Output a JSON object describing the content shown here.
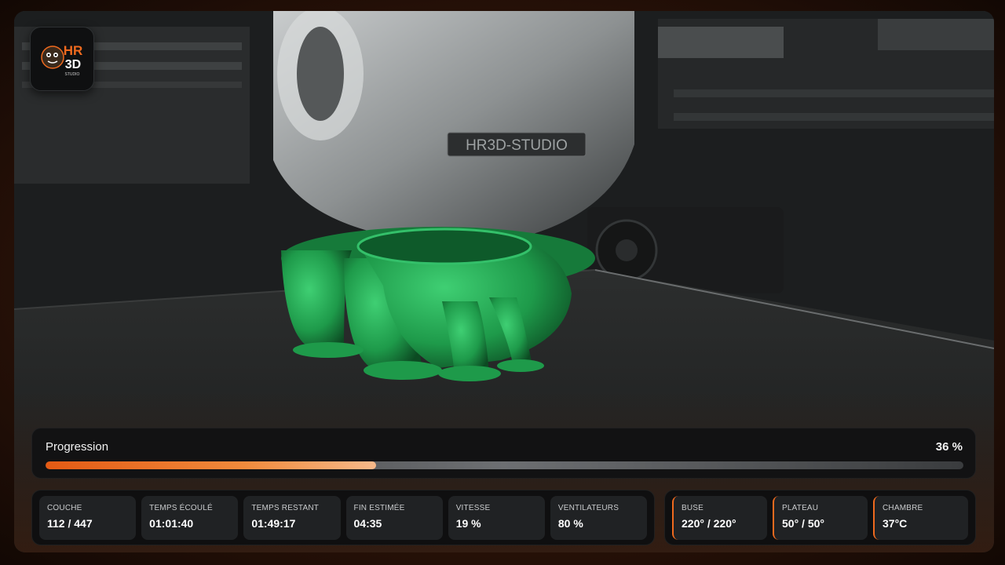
{
  "logo": {
    "line1": "HR",
    "line2": "3D",
    "line3": "STUDIO"
  },
  "machine_label": "HR3D-STUDIO",
  "progress": {
    "label": "Progression",
    "percent_text": "36 %",
    "fraction": 0.36
  },
  "stats": [
    {
      "label": "COUCHE",
      "value": "112 / 447"
    },
    {
      "label": "TEMPS ÉCOULÉ",
      "value": "01:01:40"
    },
    {
      "label": "TEMPS RESTANT",
      "value": "01:49:17"
    },
    {
      "label": "FIN ESTIMÉE",
      "value": "04:35"
    },
    {
      "label": "VITESSE",
      "value": "19 %"
    },
    {
      "label": "VENTILATEURS",
      "value": "80 %"
    }
  ],
  "temps": [
    {
      "label": "BUSE",
      "value": "220° / 220°"
    },
    {
      "label": "PLATEAU",
      "value": "50° / 50°"
    },
    {
      "label": "CHAMBRE",
      "value": "37°C"
    }
  ],
  "colors": {
    "accent": "#f06a1e",
    "filament": "#1e9a4a"
  }
}
